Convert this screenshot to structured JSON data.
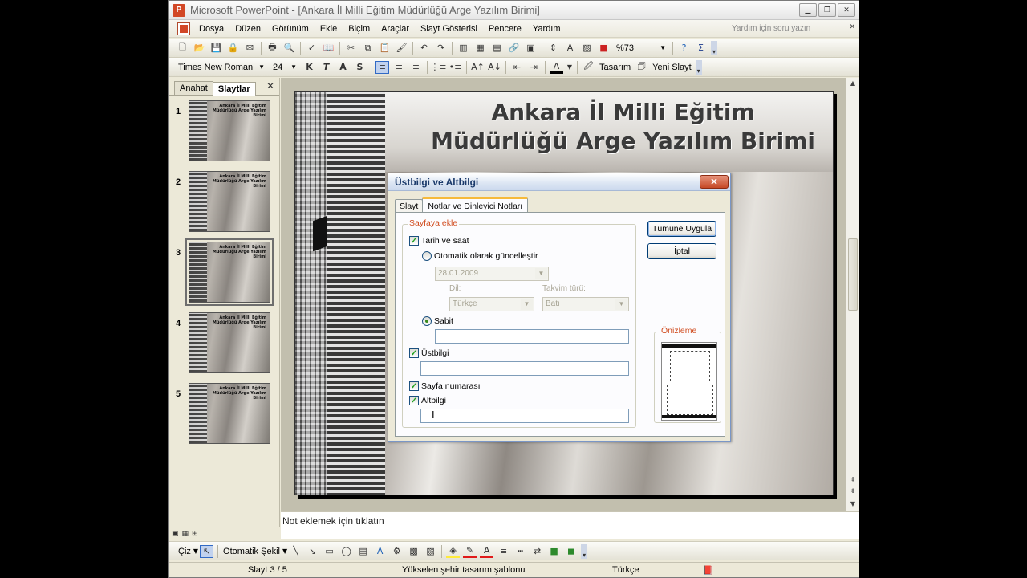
{
  "window": {
    "title": "Microsoft PowerPoint - [Ankara İl Milli Eğitim Müdürlüğü Arge Yazılım Birimi]"
  },
  "menu": {
    "items": [
      "Dosya",
      "Düzen",
      "Görünüm",
      "Ekle",
      "Biçim",
      "Araçlar",
      "Slayt Gösterisi",
      "Pencere",
      "Yardım"
    ],
    "help_placeholder": "Yardım için soru yazın"
  },
  "toolbar": {
    "zoom": "%73",
    "font_name": "Times New Roman",
    "font_size": "24",
    "bold": "K",
    "italic": "T",
    "underline": "A",
    "shadow": "S",
    "design_label": "Tasarım",
    "new_slide_label": "Yeni Slayt"
  },
  "side_pane": {
    "tab_outline": "Anahat",
    "tab_slides": "Slaytlar",
    "thumbs": [
      {
        "num": "1",
        "title": "Ankara İl Milli Eğitim Müdürlüğü Arge Yazılım Birimi"
      },
      {
        "num": "2",
        "title": "Ankara İl Milli Eğitim Müdürlüğü Arge Yazılım Birimi"
      },
      {
        "num": "3",
        "title": "Ankara İl Milli Eğitim Müdürlüğü Arge Yazılım Birimi"
      },
      {
        "num": "4",
        "title": "Ankara İl Milli Eğitim Müdürlüğü Arge Yazılım Birimi"
      },
      {
        "num": "5",
        "title": "Ankara İl Milli Eğitim Müdürlüğü Arge Yazılım Birimi"
      }
    ],
    "selected_index": 2
  },
  "slide": {
    "title_line1": "Ankara İl Milli Eğitim",
    "title_line2": "Müdürlüğü Arge Yazılım Birimi"
  },
  "notes": {
    "placeholder": "Not eklemek için tıklatın"
  },
  "drawing": {
    "draw_label": "Çiz",
    "autoshapes_label": "Otomatik Şekil"
  },
  "status": {
    "slide_pos": "Slayt 3 / 5",
    "template": "Yükselen şehir tasarım şablonu",
    "language": "Türkçe"
  },
  "dialog": {
    "title": "Üstbilgi ve Altbilgi",
    "tabs": [
      "Slayt",
      "Notlar ve Dinleyici Notları"
    ],
    "active_tab": 1,
    "group_label": "Sayfaya ekle",
    "date_time": {
      "label": "Tarih ve saat",
      "checked": true
    },
    "auto_update": {
      "label": "Otomatik olarak güncelleştir",
      "selected": false
    },
    "date_value": "28.01.2009",
    "language_label": "Dil:",
    "language_value": "Türkçe",
    "calendar_label": "Takvim türü:",
    "calendar_value": "Batı",
    "fixed": {
      "label": "Sabit",
      "selected": true
    },
    "fixed_value": "",
    "header": {
      "label": "Üstbilgi",
      "checked": true
    },
    "header_value": "",
    "page_number": {
      "label": "Sayfa numarası",
      "checked": true
    },
    "footer": {
      "label": "Altbilgi",
      "checked": true
    },
    "footer_value": "",
    "apply_all": "Tümüne Uygula",
    "cancel": "İptal",
    "preview_label": "Önizleme"
  }
}
